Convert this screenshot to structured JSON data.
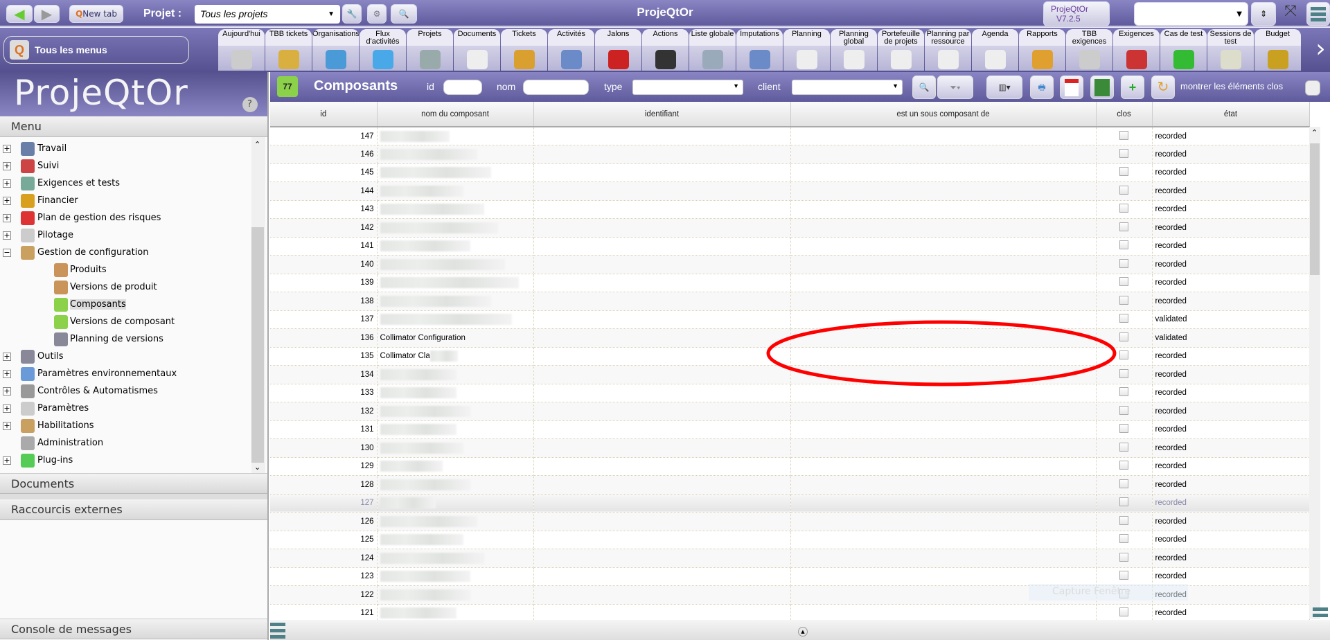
{
  "topbar": {
    "new_tab": "New tab",
    "project_label": "Projet :",
    "project_value": "Tous les projets",
    "app_title": "ProjeQtOr",
    "version_line1": "ProjeQtOr",
    "version_line2": "V7.2.5"
  },
  "menubar": {
    "all_menus": "Tous les menus",
    "tabs": [
      "Aujourd'hui",
      "TBB tickets",
      "Organisations",
      "Flux d'activités",
      "Projets",
      "Documents",
      "Tickets",
      "Activités",
      "Jalons",
      "Actions",
      "Liste globale",
      "Imputations",
      "Planning",
      "Planning global",
      "Portefeuille de projets",
      "Planning par ressource",
      "Agenda",
      "Rapports",
      "TBB exigences",
      "Exigences",
      "Cas de test",
      "Sessions de test",
      "Budget"
    ]
  },
  "sidebar": {
    "logo": "ProjeQtOr",
    "menu_header": "Menu",
    "items": [
      {
        "label": "Travail",
        "color": "#6a7fa8"
      },
      {
        "label": "Suivi",
        "color": "#c44"
      },
      {
        "label": "Exigences et tests",
        "color": "#7a9"
      },
      {
        "label": "Financier",
        "color": "#d9a020"
      },
      {
        "label": "Plan de gestion des risques",
        "color": "#d33"
      },
      {
        "label": "Pilotage",
        "color": "#ccc"
      },
      {
        "label": "Gestion de configuration",
        "color": "#c9a060"
      }
    ],
    "sub_items": [
      {
        "label": "Produits",
        "color": "#c9935a"
      },
      {
        "label": "Versions de produit",
        "color": "#c9935a"
      },
      {
        "label": "Composants",
        "color": "#8bd14a"
      },
      {
        "label": "Versions de composant",
        "color": "#8bd14a"
      },
      {
        "label": "Planning de versions",
        "color": "#889"
      }
    ],
    "items2": [
      {
        "label": "Outils",
        "color": "#889"
      },
      {
        "label": "Paramètres environnementaux",
        "color": "#6a9ad8"
      },
      {
        "label": "Contrôles & Automatismes",
        "color": "#999"
      },
      {
        "label": "Paramètres",
        "color": "#ccc"
      },
      {
        "label": "Habilitations",
        "color": "#c9a060"
      },
      {
        "label": "Administration",
        "color": "#aaa"
      },
      {
        "label": "Plug-ins",
        "color": "#5c5"
      }
    ],
    "documents": "Documents",
    "shortcuts": "Raccourcis externes",
    "console": "Console de messages"
  },
  "main": {
    "title": "Composants",
    "filters": {
      "id": "id",
      "name": "nom",
      "type": "type",
      "client": "client"
    },
    "show_closed": "montrer les éléments clos",
    "columns": [
      "id",
      "nom du composant",
      "identifiant",
      "est un sous composant de",
      "clos",
      "état"
    ],
    "rows": [
      {
        "id": "147",
        "name": "",
        "state": "recorded"
      },
      {
        "id": "146",
        "name": "",
        "state": "recorded"
      },
      {
        "id": "145",
        "name": "",
        "state": "recorded"
      },
      {
        "id": "144",
        "name": "",
        "state": "recorded"
      },
      {
        "id": "143",
        "name": "",
        "state": "recorded"
      },
      {
        "id": "142",
        "name": "",
        "state": "recorded"
      },
      {
        "id": "141",
        "name": "",
        "state": "recorded"
      },
      {
        "id": "140",
        "name": "",
        "state": "recorded"
      },
      {
        "id": "139",
        "name": "",
        "state": "recorded"
      },
      {
        "id": "138",
        "name": "",
        "state": "recorded"
      },
      {
        "id": "137",
        "name": "",
        "state": "validated"
      },
      {
        "id": "136",
        "name": "Collimator Configuration",
        "state": "validated"
      },
      {
        "id": "135",
        "name": "Collimator Cla",
        "state": "recorded"
      },
      {
        "id": "134",
        "name": "",
        "state": "recorded"
      },
      {
        "id": "133",
        "name": "",
        "state": "recorded"
      },
      {
        "id": "132",
        "name": "",
        "state": "recorded"
      },
      {
        "id": "131",
        "name": "",
        "state": "recorded"
      },
      {
        "id": "130",
        "name": "",
        "state": "recorded"
      },
      {
        "id": "129",
        "name": "",
        "state": "recorded"
      },
      {
        "id": "128",
        "name": "",
        "state": "recorded"
      },
      {
        "id": "127",
        "name": "",
        "state": "recorded"
      },
      {
        "id": "126",
        "name": "",
        "state": "recorded"
      },
      {
        "id": "125",
        "name": "",
        "state": "recorded"
      },
      {
        "id": "124",
        "name": "",
        "state": "recorded"
      },
      {
        "id": "123",
        "name": "",
        "state": "recorded"
      },
      {
        "id": "122",
        "name": "",
        "state": "recorded"
      },
      {
        "id": "121",
        "name": "",
        "state": "recorded"
      }
    ],
    "tooltip": "Capture Fenêtre"
  },
  "colors": {
    "accent": "#6e69ab",
    "annotation": "#ff0000"
  }
}
